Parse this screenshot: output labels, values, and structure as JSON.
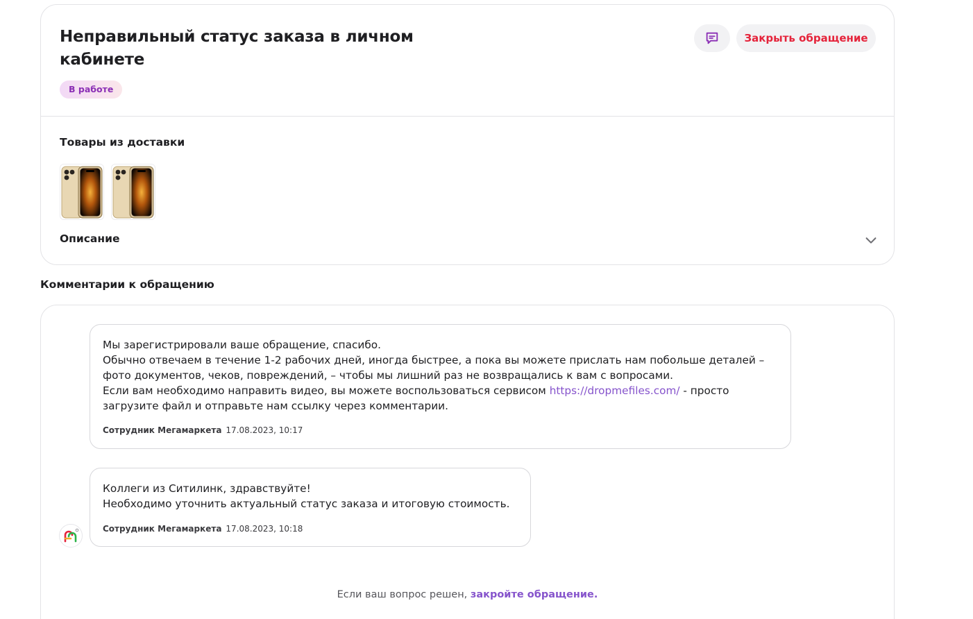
{
  "ticket": {
    "title": "Неправильный статус заказа в личном кабинете",
    "status": "В работе",
    "close_button": "Закрыть обращение",
    "chat_icon": "chat-bubble-icon"
  },
  "goods": {
    "heading": "Товары из доставки",
    "items": [
      {
        "icon": "phone-product-image"
      },
      {
        "icon": "phone-product-image"
      }
    ]
  },
  "description": {
    "label": "Описание",
    "icon": "chevron-down-icon"
  },
  "comments": {
    "heading": "Комментарии к обращению",
    "items": [
      {
        "text_before_link": "Мы зарегистрировали ваше обращение, спасибо.\nОбычно отвечаем в течение 1-2 рабочих дней, иногда быстрее, а пока вы можете прислать нам побольше деталей – фото документов, чеков, повреждений, – чтобы мы лишний раз не возвращались к вам с вопросами.\nЕсли вам необходимо направить видео, вы можете воспользоваться сервисом ",
        "link": "https://dropmefiles.com/",
        "text_after_link": " - просто загрузите файл и отправьте нам ссылку через комментарии.",
        "author": "Сотрудник Мегамаркета",
        "timestamp": "17.08.2023, 10:17"
      },
      {
        "text": "Коллеги из Ситилинк, здравствуйте!\nНеобходимо уточнить актуальный статус заказа и итоговую стоимость.",
        "author": "Сотрудник Мегамаркета",
        "timestamp": "17.08.2023, 10:18"
      }
    ],
    "footer_text": "Если ваш вопрос решен, ",
    "footer_link": "закройте обращение."
  },
  "colors": {
    "accent": "#8654cc",
    "danger": "#e5243b",
    "status_text": "#8b2fb5"
  }
}
